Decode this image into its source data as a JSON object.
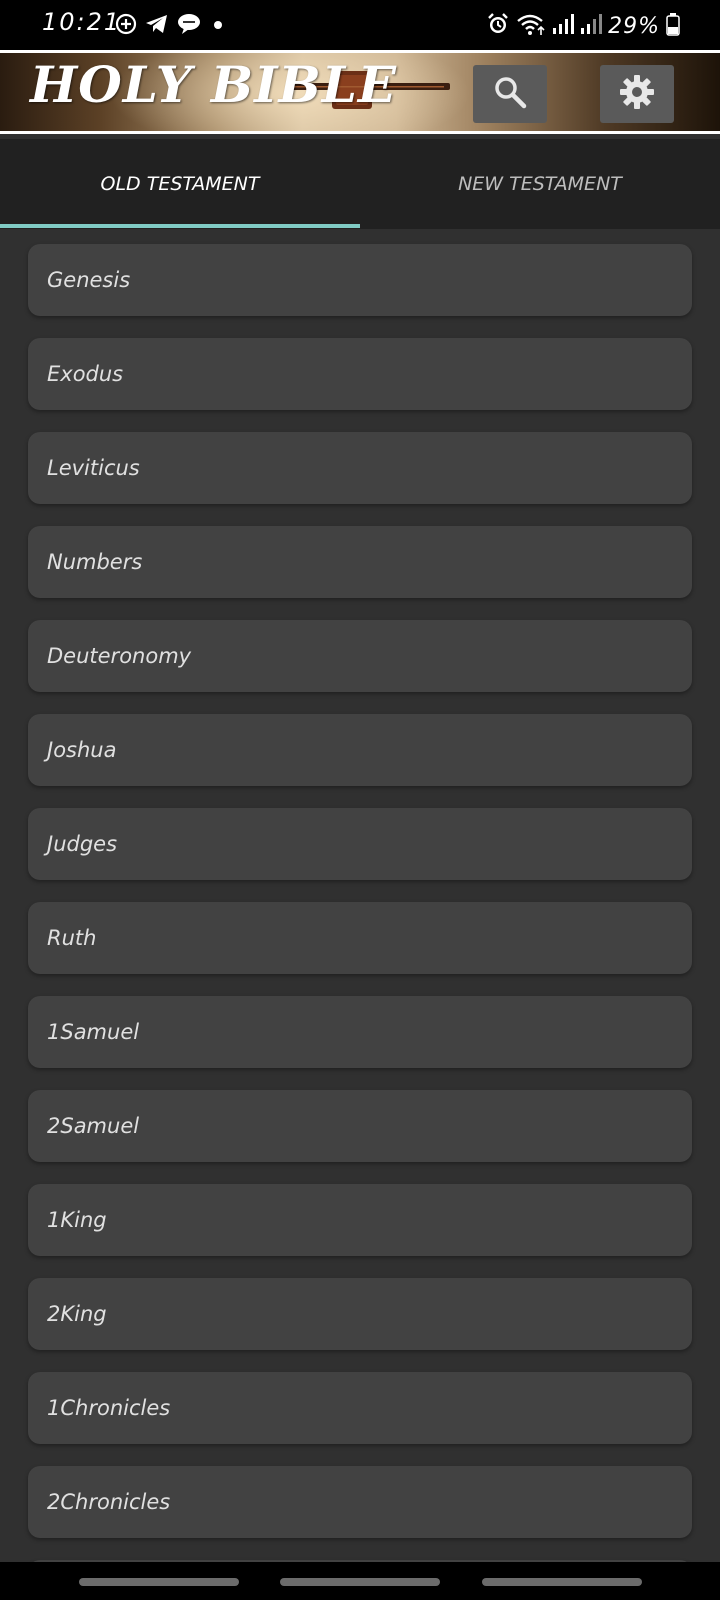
{
  "status_bar": {
    "time": "10:21",
    "battery": "29%",
    "left_icons": [
      "add-circle-icon",
      "telegram-icon",
      "chat-bubble-icon",
      "dot-icon"
    ],
    "right_icons": [
      "alarm-icon",
      "wifi-icon",
      "signal-icon",
      "signal-icon",
      "battery-icon"
    ]
  },
  "header": {
    "title": "HOLY BIBLE",
    "search_icon": "search-icon",
    "settings_icon": "gear-icon"
  },
  "tabs": {
    "items": [
      {
        "label": "OLD TESTAMENT",
        "selected": true
      },
      {
        "label": "NEW TESTAMENT",
        "selected": false
      }
    ],
    "indicator_color": "#80cbc4"
  },
  "books": [
    {
      "label": "Genesis"
    },
    {
      "label": "Exodus"
    },
    {
      "label": "Leviticus"
    },
    {
      "label": "Numbers"
    },
    {
      "label": "Deuteronomy"
    },
    {
      "label": "Joshua"
    },
    {
      "label": "Judges"
    },
    {
      "label": "Ruth"
    },
    {
      "label": "1Samuel"
    },
    {
      "label": "2Samuel"
    },
    {
      "label": "1King"
    },
    {
      "label": "2King"
    },
    {
      "label": "1Chronicles"
    },
    {
      "label": "2Chronicles"
    },
    {
      "label": ""
    }
  ],
  "colors": {
    "background": "#303030",
    "card": "#424242",
    "tab_bar": "#212121",
    "text": "#e0e0e0"
  }
}
